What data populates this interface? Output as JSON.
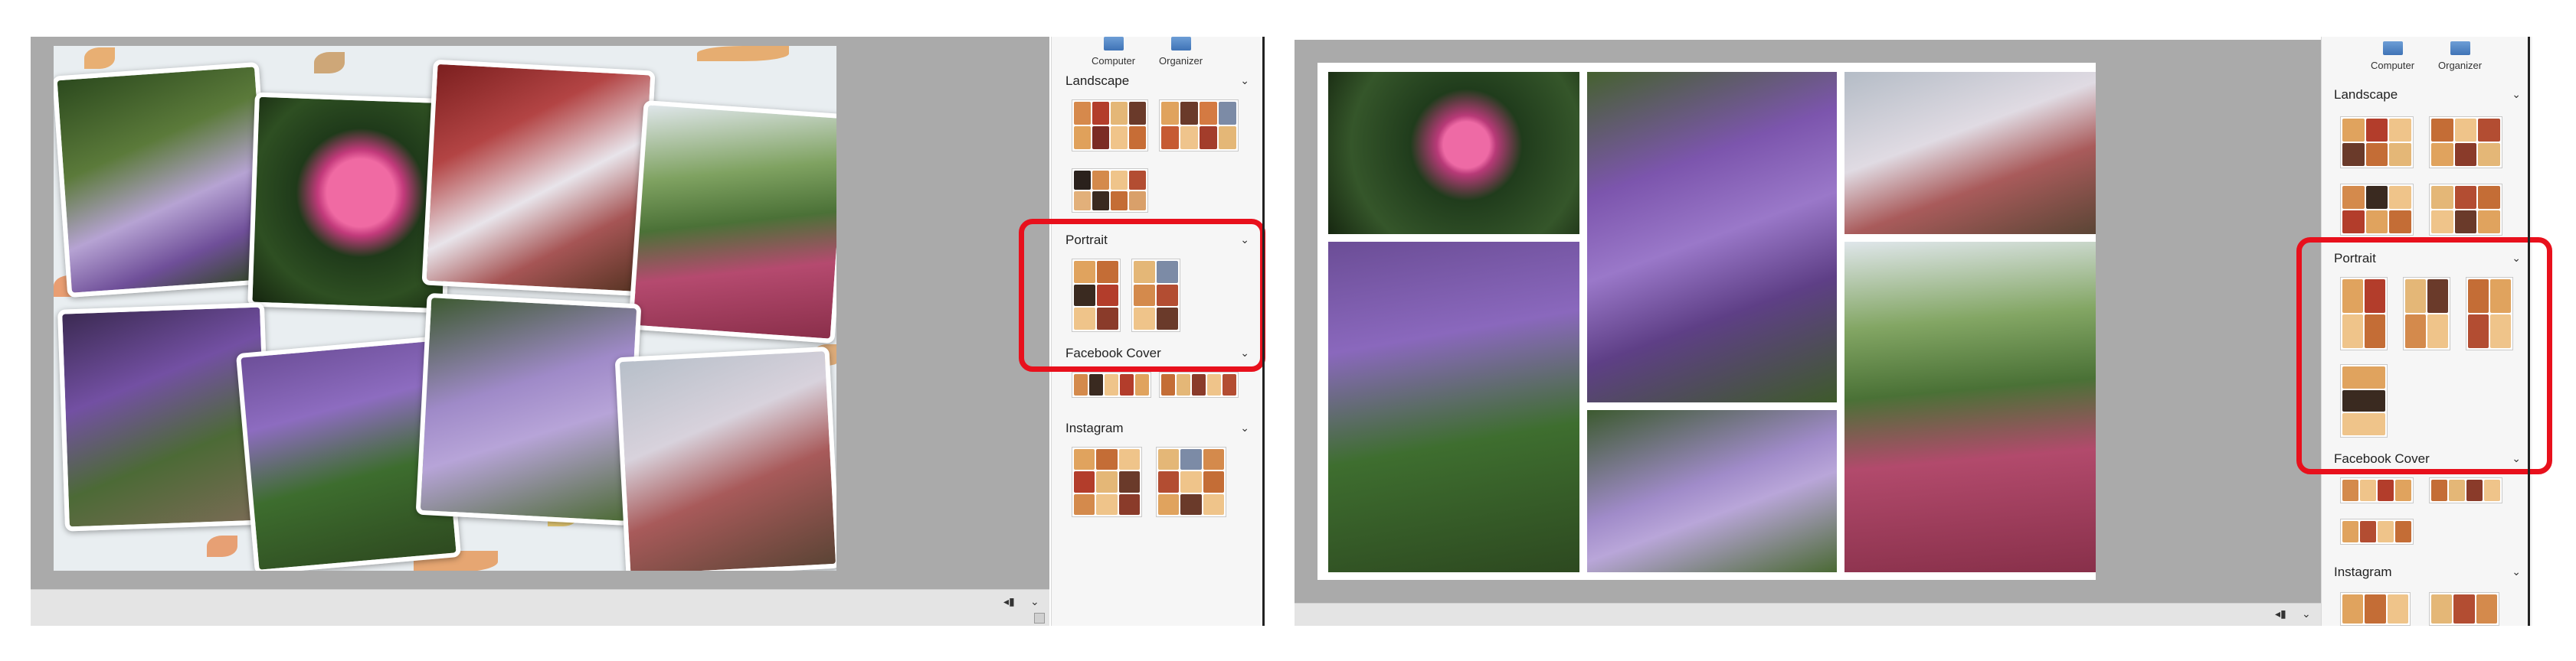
{
  "colors": {
    "highlight": "#e8101c",
    "canvas": "#aaaaaa",
    "sidebar_bg": "#f6f6f6"
  },
  "left": {
    "toolbar": {
      "computer_label": "Computer",
      "organizer_label": "Organizer"
    },
    "sections": [
      {
        "label": "Landscape"
      },
      {
        "label": "Portrait"
      },
      {
        "label": "Facebook Cover"
      },
      {
        "label": "Instagram"
      }
    ]
  },
  "right": {
    "toolbar": {
      "computer_label": "Computer",
      "organizer_label": "Organizer"
    },
    "sections": [
      {
        "label": "Landscape"
      },
      {
        "label": "Portrait"
      },
      {
        "label": "Facebook Cover"
      },
      {
        "label": "Instagram"
      }
    ]
  },
  "icons": {
    "expand": "chevron-down-icon",
    "computer": "computer-icon",
    "organizer": "organizer-icon",
    "resize": "resize-grip-icon"
  }
}
